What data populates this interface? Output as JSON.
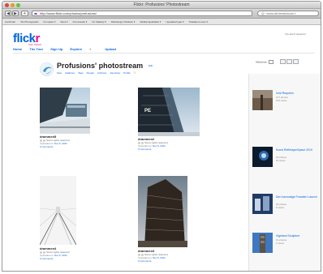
{
  "browser": {
    "window_title": "Flickr: Profusions' Photostream",
    "url": "http://www.flickr.com/photos/profusions/",
    "search_placeholder": "Q~ www.dinterstickran.t"
  },
  "bookmarks": [
    "Iconfinder",
    "Stir Photographs",
    "Kompass ▾",
    "Mera ▾",
    "Kommande ▾",
    "Oc Flaketty ▾",
    "Webdesign Publisier ▾",
    "Webbprojektdatar ▾",
    "Uppdatteringar ▾",
    "Tidslatters anos ▾"
  ],
  "header": {
    "logo_blue": "flickr",
    "logo_tagline": "from Yahoo!",
    "signin": "You aren't signed in"
  },
  "nav": [
    "Home",
    "The Tour",
    "Sign Up",
    "Explore",
    "Upload"
  ],
  "nav_dropdown": "▾",
  "photostream": {
    "title": "Profusions' photostream",
    "edit": "Edit",
    "sublinks": [
      "Sets",
      "Galleries",
      "Tags",
      "People",
      "Archives",
      "Favorites",
      "Profile",
      "☰"
    ],
    "slideshow": "Slideshow",
    "photos": [
      {
        "title": "drammen5",
        "rights": "Some rights reserved",
        "uploaded_prefix": "Uploaded on",
        "uploaded_date": "Nov 5, 2011",
        "comments": "0 comments"
      },
      {
        "title": "drammen2",
        "rights": "Some rights reserved",
        "uploaded_prefix": "Uploaded on",
        "uploaded_date": "Nov 5, 2011",
        "comments": "0 comments"
      },
      {
        "title": "drammen4",
        "rights": "Some rights reserved",
        "uploaded_prefix": "Uploaded on",
        "uploaded_date": "Nov 5, 2011",
        "comments": "0 comments"
      },
      {
        "title": "drammen3",
        "rights": "Some rights reserved",
        "uploaded_prefix": "Uploaded on",
        "uploaded_date": "Nov 5, 2011",
        "comments": "0 comments"
      }
    ]
  },
  "sets": [
    {
      "title": "Void Requiem",
      "meta1": "147 photos",
      "meta2": "153 views"
    },
    {
      "title": "Kunst RefleksjonSpace 2010",
      "meta1": "18 photos",
      "meta2": "19 views"
    },
    {
      "title": "Den havmatige Porselen Launch",
      "meta1": "23 photos",
      "meta2": "8 views"
    },
    {
      "title": "Vigeland Sculpture",
      "meta1": "19 photos",
      "meta2": "2 views"
    }
  ],
  "colors": {
    "flickr_blue": "#0063dc",
    "flickr_pink": "#ff0084",
    "link": "#0063dc"
  }
}
